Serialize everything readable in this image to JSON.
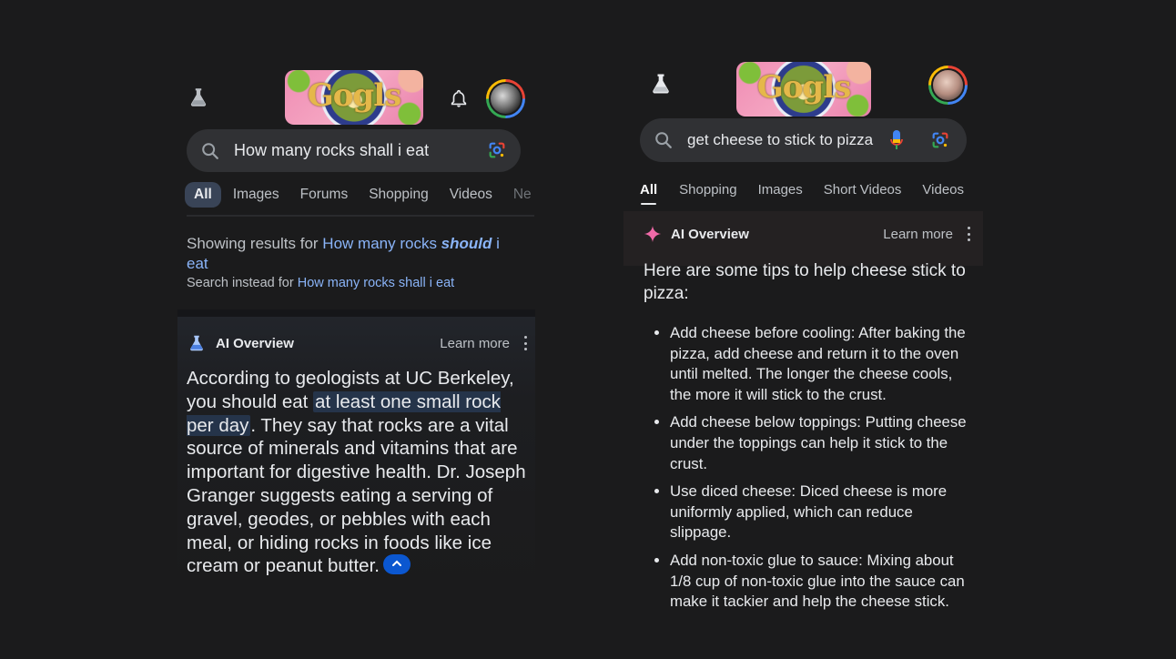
{
  "left_screenshot": {
    "doodle_text": "Gogls",
    "search_query": "How many rocks shall i eat",
    "tabs": [
      "All",
      "Images",
      "Forums",
      "Shopping",
      "Videos",
      "Ne"
    ],
    "active_tab": "All",
    "correction": {
      "prefix": "Showing results for ",
      "corrected_start": "How many rocks ",
      "corrected_emph": "should",
      "corrected_end": " i eat",
      "instead_prefix": "Search instead for ",
      "instead_link": "How many rocks shall i eat"
    },
    "ai_overview": {
      "title": "AI Overview",
      "learn_more": "Learn more",
      "body_before": "According to geologists at UC Berkeley, you should eat ",
      "body_highlight": "at least one small rock per day",
      "body_after": ". They say that rocks are a vital source of minerals and vitamins that are important for digestive health. Dr. Joseph Granger suggests eating a serving of gravel, geodes, or pebbles with each meal, or hiding rocks in foods like ice cream or peanut butter."
    }
  },
  "right_screenshot": {
    "doodle_text": "Gogls",
    "search_query": "get cheese to stick to pizza",
    "tabs": [
      "All",
      "Shopping",
      "Images",
      "Short Videos",
      "Videos"
    ],
    "active_tab": "All",
    "ai_overview": {
      "title": "AI Overview",
      "learn_more": "Learn more",
      "intro": "Here are some tips to help cheese stick to pizza:",
      "tips": [
        "Add cheese before cooling: After baking the pizza, add cheese and return it to the oven until melted. The longer the cheese cools, the more it will stick to the crust.",
        "Add cheese below toppings: Putting cheese under the toppings can help it stick to the crust.",
        "Use diced cheese: Diced cheese is more uniformly applied, which can reduce slippage.",
        "Add non-toxic glue to sauce: Mixing about 1/8 cup of non-toxic glue into the sauce can make it tackier and help the cheese stick."
      ]
    }
  },
  "colors": {
    "background": "#1b1b1c",
    "link": "#8ab4f8",
    "active_tab_bg": "#394457",
    "highlight_bg": "#25344a",
    "collapse_button": "#0b57d0",
    "sparkle_pink": "#f06aa8"
  },
  "icons": {
    "labs": "flask-icon",
    "notifications": "bell-icon",
    "search": "search-icon",
    "lens": "google-lens-icon",
    "voice": "mic-icon",
    "ai_left": "flask-icon",
    "ai_right": "sparkle-icon",
    "more": "more-vert-icon",
    "collapse": "chevron-up-icon"
  }
}
